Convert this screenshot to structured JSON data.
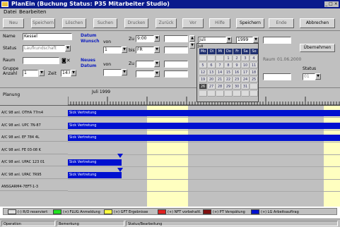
{
  "window": {
    "title": "PlanEin (Buchung Status: P35 Mitarbeiter Studio)",
    "controls": "_ □ ×"
  },
  "menu": [
    "Datei",
    "Bearbeiten"
  ],
  "toolbar": {
    "buttons": [
      "Neu",
      "Speichern",
      "Löschen",
      "Suchen",
      "Drucken",
      "Zurück",
      "Vor",
      "Hilfe",
      "Speichern",
      "Ende",
      "Abbrechen"
    ]
  },
  "form": {
    "name_label": "Name",
    "name_value": "Kessel",
    "status_label": "Status",
    "status_value": "Laufkundschaft",
    "row3_label": "Raum",
    "row4_label": "Gruppe",
    "anzahl_label": "Anzahl",
    "anzahl_value": "1",
    "zeit_label": "Zeit",
    "zeit_value": "14:0",
    "dates_heading": "Datum Wunsch",
    "dates_heading2": "Neues Datum",
    "von_label": "von",
    "bis_label": "bis",
    "von_value": "1",
    "bis_value": "FR",
    "zu_label": "Zu",
    "zu_value": "9:00",
    "row2_zu_label": "Zu",
    "right_btn1": "Abbrechen",
    "right_btn2": "Übernehmen",
    "gueltig_label": "Raum",
    "gueltig_value": "01.06.2000",
    "status2_label": "Status",
    "status2_value": "01"
  },
  "calendar": {
    "month": "Juli",
    "year": "1999",
    "days": [
      "Mo",
      "Di",
      "Mi",
      "Do",
      "Fr",
      "Sa",
      "So"
    ],
    "cells": [
      "",
      "",
      "",
      "1",
      "2",
      "3",
      "4",
      "5",
      "6",
      "7",
      "8",
      "9",
      "10",
      "11",
      "12",
      "13",
      "14",
      "15",
      "16",
      "17",
      "18",
      "19",
      "20",
      "21",
      "22",
      "23",
      "24",
      "25",
      "26",
      "27",
      "28",
      "29",
      "30",
      "31",
      "",
      "",
      "",
      "",
      "",
      "",
      "",
      ""
    ],
    "selected": "26"
  },
  "schedule": {
    "header_label": "Planung",
    "date_label": "Juli 1999",
    "rows": [
      {
        "label": "A/C 98 anl. OTHA 77m4"
      },
      {
        "label": "A/C 98 anl. UPC 7N-87"
      },
      {
        "label": "A/C 98 anl. EF 784 4L"
      },
      {
        "label": "A/C 98 anl. FE 03-08 K"
      },
      {
        "label": "A/C 98 anl. UPAC 123 01"
      },
      {
        "label": "A/C 98 anl. UPAC 7R95"
      },
      {
        "label": "ANSGARM4-7EFT-1-3"
      }
    ],
    "bars": [
      {
        "row": 0,
        "text": "Sick Vertretung"
      },
      {
        "row": 1,
        "text": "Sick Vertretung"
      },
      {
        "row": 2,
        "text": "Sick Vertretung"
      },
      {
        "row": 4,
        "text": "Sick Vertretung"
      },
      {
        "row": 5,
        "text": "Sick Vertretung"
      }
    ]
  },
  "legend": [
    {
      "label": "(-) R/O reserviert",
      "color": "#e0e0e0"
    },
    {
      "label": "(+) FLUG Anmeldung",
      "color": "#20e020"
    },
    {
      "label": "(+) GFT Ergebnisse",
      "color": "#ffff40"
    },
    {
      "label": "(+) NFT vorbehaltl.",
      "color": "#e02020"
    },
    {
      "label": "(+) PT Verspätung",
      "color": "#801010"
    },
    {
      "label": "(+) LG Arbeitsauftrag",
      "color": "#0010d0"
    }
  ],
  "status": {
    "c1": "Operation",
    "c2": "Bemerkung",
    "c3": "Status/Bearbeitung"
  }
}
